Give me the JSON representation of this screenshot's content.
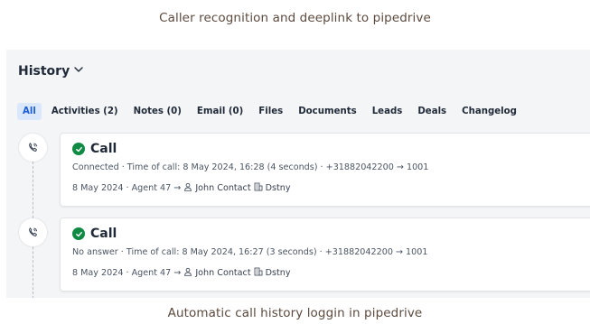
{
  "captions": {
    "top": "Caller recognition and deeplink to pipedrive",
    "bottom": "Automatic call history loggin in pipedrive"
  },
  "history": {
    "title": "History",
    "tabs": [
      {
        "label": "All",
        "active": true
      },
      {
        "label": "Activities (2)"
      },
      {
        "label": "Notes (0)"
      },
      {
        "label": "Email (0)"
      },
      {
        "label": "Files"
      },
      {
        "label": "Documents"
      },
      {
        "label": "Leads"
      },
      {
        "label": "Deals"
      },
      {
        "label": "Changelog"
      }
    ],
    "entries": [
      {
        "title": "Call",
        "details": "Connected · Time of call: 8 May 2024, 16:28 (4 seconds) · +31882042200 → 1001",
        "meta_prefix": "8 May 2024 · Agent 47 →",
        "person": "John Contact",
        "org": "Dstny"
      },
      {
        "title": "Call",
        "details": "No answer · Time of call: 8 May 2024, 16:27 (3 seconds) · +31882042200 → 1001",
        "meta_prefix": "8 May 2024 · Agent 47 →",
        "person": "John Contact",
        "org": "Dstny"
      }
    ]
  },
  "colors": {
    "accent_blue": "#1d5fd3",
    "status_green": "#0f8a43",
    "panel_bg": "#f4f5f7"
  },
  "icons": [
    "chevron-down-icon",
    "phone-call-icon",
    "check-circle-icon",
    "person-icon",
    "building-icon"
  ]
}
